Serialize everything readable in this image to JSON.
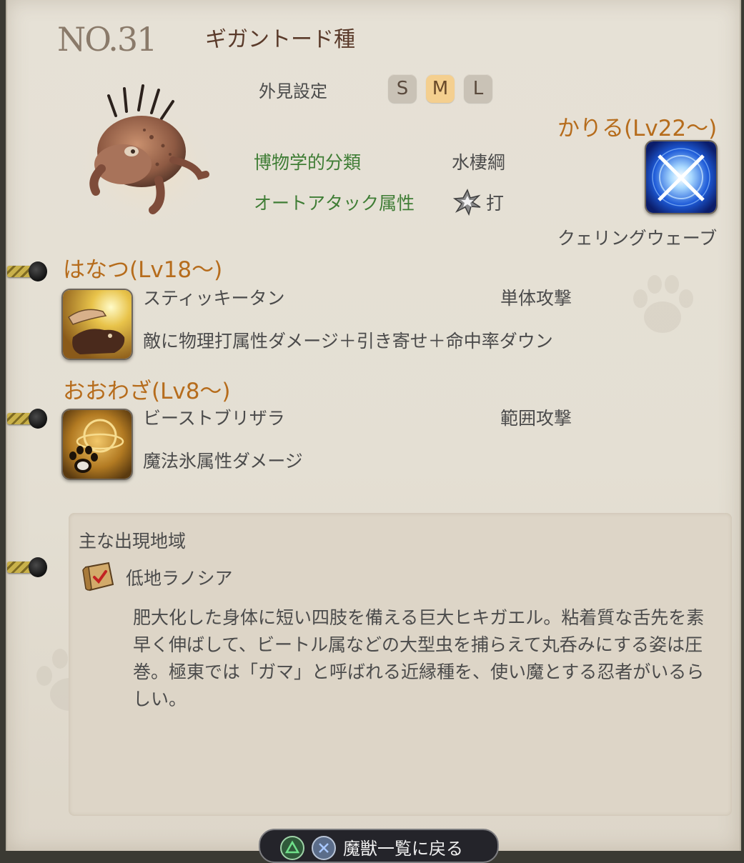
{
  "entry": {
    "number": "NO.31",
    "name": "ギガントード種"
  },
  "appearance": {
    "label": "外見設定",
    "sizes": [
      "S",
      "M",
      "L"
    ],
    "selected": "M"
  },
  "classification": {
    "label": "博物学的分類",
    "value": "水棲綱"
  },
  "auto_attack": {
    "label": "オートアタック属性",
    "value": "打",
    "icon": "blunt-attack-icon"
  },
  "kariru": {
    "title": "かりる(Lv22～)",
    "skill": "クェリングウェーブ",
    "icon": "quelling-wave-icon"
  },
  "hanatsu": {
    "title": "はなつ(Lv18～)",
    "skill": "スティッキータン",
    "target": "単体攻撃",
    "effect": "敵に物理打属性ダメージ＋引き寄せ＋命中率ダウン",
    "icon": "sticky-tongue-icon"
  },
  "oowaza": {
    "title": "おおわざ(Lv8～)",
    "skill": "ビーストブリザラ",
    "target": "範囲攻撃",
    "effect": "魔法氷属性ダメージ",
    "icon": "beast-blizzara-icon"
  },
  "habitat": {
    "label": "主な出現地域",
    "region": "低地ラノシア",
    "region_icon": "map-scroll-icon",
    "description": "肥大化した身体に短い四肢を備える巨大ヒキガエル。粘着質な舌先を素早く伸ばして、ビートル属などの大型虫を捕らえて丸呑みにする姿は圧巻。極東では「ガマ」と呼ばれる近縁種を、使い魔とする忍者がいるらしい。"
  },
  "footer": {
    "back_label": "魔獣一覧に戻る"
  },
  "colors": {
    "accent_orange": "#b66c1c",
    "accent_green": "#3f7d35",
    "selected_size": "#f4cf8f"
  }
}
